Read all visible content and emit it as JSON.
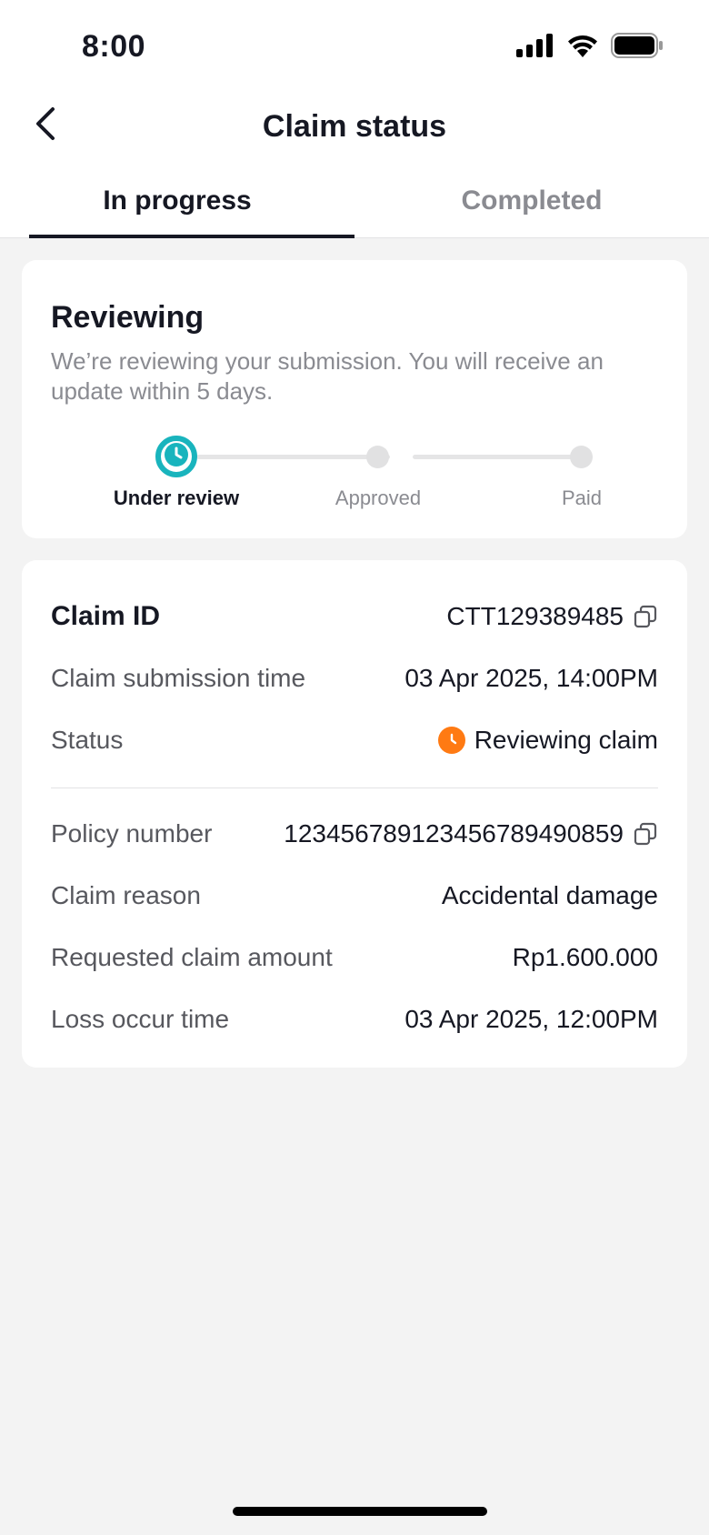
{
  "statusbar": {
    "time": "8:00"
  },
  "header": {
    "title": "Claim status"
  },
  "tabs": [
    {
      "label": "In progress",
      "active": true
    },
    {
      "label": "Completed",
      "active": false
    }
  ],
  "review": {
    "heading": "Reviewing",
    "description": "We’re reviewing your submission. You will receive an update within 5 days.",
    "steps": [
      {
        "label": "Under review",
        "state": "current"
      },
      {
        "label": "Approved",
        "state": "pending"
      },
      {
        "label": "Paid",
        "state": "pending"
      }
    ]
  },
  "details": {
    "claim_id_label": "Claim ID",
    "claim_id_value": "CTT129389485",
    "submission_label": "Claim submission time",
    "submission_value": "03 Apr 2025, 14:00PM",
    "status_label": "Status",
    "status_value": "Reviewing claim",
    "policy_label": "Policy number",
    "policy_value": "1234567891234567894​90859",
    "reason_label": "Claim reason",
    "reason_value": "Accidental damage",
    "amount_label": "Requested claim amount",
    "amount_value": "Rp1.600.000",
    "loss_label": "Loss occur time",
    "loss_value": "03 Apr 2025, 12:00PM"
  },
  "colors": {
    "accent_teal": "#19b4bd",
    "status_orange": "#ff7a13",
    "text_primary": "#161823",
    "text_secondary": "#8a8b91"
  }
}
